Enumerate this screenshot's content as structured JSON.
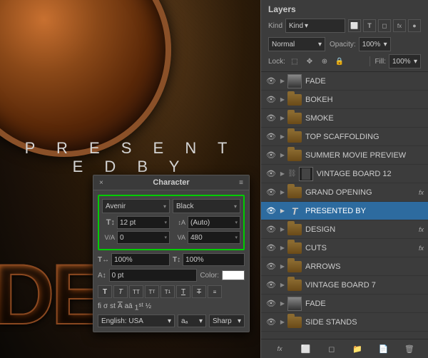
{
  "canvas": {
    "presented_by_text": "P R E S E N T E D   B Y",
    "big_letters": "DE"
  },
  "character_panel": {
    "title": "Character",
    "close_icon": "×",
    "menu_icon": "≡",
    "font_family": "Avenir",
    "font_style": "Black",
    "font_size": "12 pt",
    "font_size_arrow": "▾",
    "leading": "(Auto)",
    "leading_arrow": "▾",
    "tracking_label": "VA",
    "tracking_value": "480",
    "tracking_arrow": "▾",
    "kerning_label": "VA",
    "kerning_value": "0",
    "scale_h": "100%",
    "scale_v": "100%",
    "baseline_label": "A↕",
    "baseline_value": "0 pt",
    "color_label": "Color:",
    "lang": "English: USA",
    "lang_arrow": "▾",
    "aa_label": "aₐ",
    "aa_arrow": "▾",
    "sharp_label": "Sharp",
    "sharp_arrow": "▾",
    "style_buttons": [
      "T",
      "T",
      "TT",
      "Tᵀ",
      "T₁",
      "T̲",
      "T̶",
      "≡"
    ],
    "lig_items": [
      "fi",
      "σ",
      "st",
      "A̅",
      "aā",
      "T¹",
      "½"
    ]
  },
  "layers_panel": {
    "title": "Layers",
    "kind_label": "Kind",
    "kind_arrow": "▾",
    "filter_icons": [
      "⬜",
      "T",
      "⬛",
      "fx",
      "●"
    ],
    "blend_mode": "Normal",
    "blend_arrow": "▾",
    "opacity_label": "Opacity:",
    "opacity_value": "100%",
    "opacity_arrow": "▾",
    "lock_label": "Lock:",
    "lock_icons": [
      "⬚",
      "✥",
      "🔒",
      "🔒"
    ],
    "fill_label": "Fill:",
    "fill_value": "100%",
    "fill_arrow": "▾",
    "layers": [
      {
        "name": "FADE",
        "type": "solid",
        "visible": true,
        "expanded": false,
        "fx": false,
        "selected": false,
        "chain": false
      },
      {
        "name": "BOKEH",
        "type": "folder",
        "visible": true,
        "expanded": false,
        "fx": false,
        "selected": false,
        "chain": false
      },
      {
        "name": "SMOKE",
        "type": "folder",
        "visible": true,
        "expanded": false,
        "fx": false,
        "selected": false,
        "chain": false
      },
      {
        "name": "TOP SCAFFOLDING",
        "type": "folder",
        "visible": true,
        "expanded": false,
        "fx": false,
        "selected": false,
        "chain": false
      },
      {
        "name": "SUMMER MOVIE PREVIEW",
        "type": "folder",
        "visible": true,
        "expanded": false,
        "fx": false,
        "selected": false,
        "chain": false
      },
      {
        "name": "VINTAGE BOARD 12",
        "type": "folder-img",
        "visible": true,
        "expanded": false,
        "fx": false,
        "selected": false,
        "chain": true
      },
      {
        "name": "GRAND OPENING",
        "type": "folder",
        "visible": true,
        "expanded": false,
        "fx": true,
        "selected": false,
        "chain": false
      },
      {
        "name": "PRESENTED BY",
        "type": "text",
        "visible": true,
        "expanded": false,
        "fx": false,
        "selected": true,
        "chain": false
      },
      {
        "name": "DESIGN",
        "type": "folder",
        "visible": true,
        "expanded": false,
        "fx": true,
        "selected": false,
        "chain": false
      },
      {
        "name": "CUTS",
        "type": "folder",
        "visible": true,
        "expanded": false,
        "fx": true,
        "selected": false,
        "chain": false
      },
      {
        "name": "ARROWS",
        "type": "folder",
        "visible": true,
        "expanded": false,
        "fx": false,
        "selected": false,
        "chain": false
      },
      {
        "name": "VINTAGE BOARD 7",
        "type": "folder",
        "visible": true,
        "expanded": false,
        "fx": false,
        "selected": false,
        "chain": false
      },
      {
        "name": "FADE",
        "type": "solid",
        "visible": true,
        "expanded": false,
        "fx": false,
        "selected": false,
        "chain": false
      },
      {
        "name": "SIDE STANDS",
        "type": "folder",
        "visible": true,
        "expanded": false,
        "fx": false,
        "selected": false,
        "chain": false
      }
    ],
    "footer_buttons": [
      "fx",
      "⬜",
      "🗑",
      "📋",
      "📁"
    ]
  }
}
